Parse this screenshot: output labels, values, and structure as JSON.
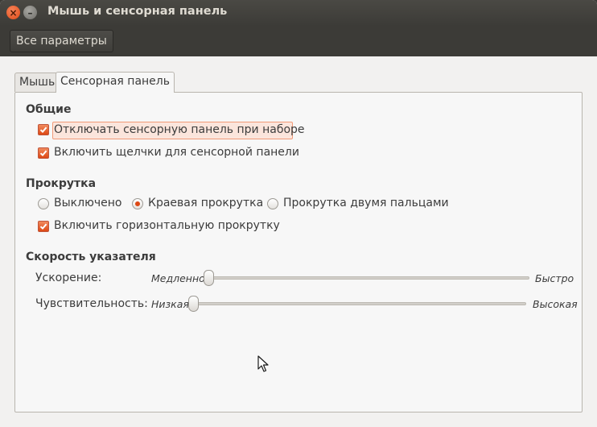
{
  "window": {
    "title": "Мышь и сенсорная панель",
    "close_glyph": "×",
    "min_glyph": "–"
  },
  "toolbar": {
    "all_settings_label": "Все параметры"
  },
  "tabs": [
    {
      "label": "Мышь",
      "active": false
    },
    {
      "label": "Сенсорная панель",
      "active": true
    }
  ],
  "general": {
    "heading": "Общие",
    "disable_while_typing": {
      "label": "Отключать сенсорную панель при наборе",
      "checked": true
    },
    "tap_to_click": {
      "label": "Включить щелчки для сенсорной панели",
      "checked": true
    }
  },
  "scrolling": {
    "heading": "Прокрутка",
    "options": [
      {
        "label": "Выключено",
        "selected": false
      },
      {
        "label": "Краевая прокрутка",
        "selected": true
      },
      {
        "label": "Прокрутка двумя пальцами",
        "selected": false
      }
    ],
    "horizontal": {
      "label": "Включить горизонтальную прокрутку",
      "checked": true
    }
  },
  "pointer_speed": {
    "heading": "Скорость указателя",
    "acceleration": {
      "label": "Ускорение:",
      "min_label": "Медленно",
      "max_label": "Быстро",
      "value": 0
    },
    "sensitivity": {
      "label": "Чувствительность:",
      "min_label": "Низкая",
      "max_label": "Высокая",
      "value": 0
    }
  },
  "colors": {
    "accent": "#dd4814",
    "titlebar": "#3c3b37",
    "window_bg": "#f2f1f0"
  },
  "icons": {
    "close": "close-icon",
    "minimize": "minimize-icon",
    "check": "checkmark-icon",
    "cursor": "mouse-pointer-icon"
  }
}
